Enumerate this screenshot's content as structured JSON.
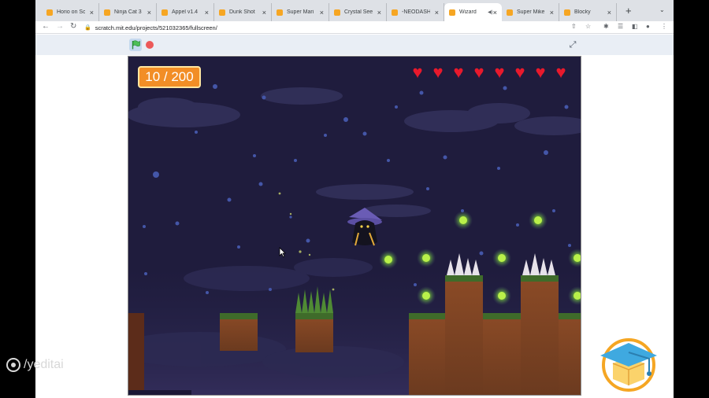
{
  "browser": {
    "tabs": [
      {
        "title": "Horio on Sc",
        "active": false
      },
      {
        "title": "Ninja Cat 3",
        "active": false
      },
      {
        "title": "Appel v1.4",
        "active": false
      },
      {
        "title": "Dunk Shot",
        "active": false
      },
      {
        "title": "Super Mari",
        "active": false
      },
      {
        "title": "Crystal See",
        "active": false
      },
      {
        "title": "-NEODASH",
        "active": false
      },
      {
        "title": "Wizard",
        "active": true
      },
      {
        "title": "Super Mike",
        "active": false
      },
      {
        "title": "Blocky",
        "active": false
      }
    ],
    "url": "scratch.mit.edu/projects/521032365/fullscreen/"
  },
  "game": {
    "score_text": "10 / 200",
    "hearts": 8,
    "colors": {
      "score_bg": "#f28e26",
      "heart": "#e8192c",
      "sky": "#1f1c3d"
    }
  },
  "watermark": {
    "handle": "/yeditai"
  }
}
